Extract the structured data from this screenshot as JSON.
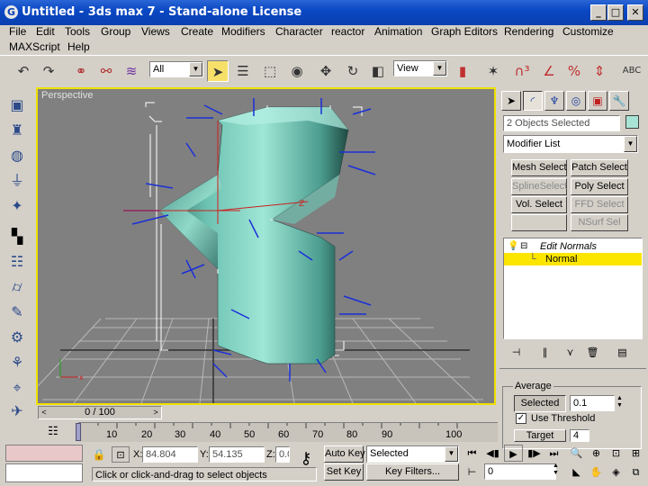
{
  "window": {
    "title": "Untitled - 3ds max 7 - Stand-alone License",
    "app_icon": "3ds-max-icon",
    "controls": [
      "_",
      "□",
      "✕"
    ]
  },
  "menu": {
    "row1": [
      "File",
      "Edit",
      "Tools",
      "Group",
      "Views",
      "Create",
      "Modifiers",
      "Character",
      "reactor",
      "Animation",
      "Graph Editors",
      "Rendering",
      "Customize"
    ],
    "row2": [
      "MAXScript",
      "Help"
    ]
  },
  "toolbar": {
    "selection_filter": "All",
    "coord_system": "View",
    "icons": [
      "undo-icon",
      "redo-icon",
      "link-icon",
      "unlink-icon",
      "bind-space-warp-icon",
      "select-object-icon",
      "select-by-name-icon",
      "rectangular-region-icon",
      "window-crossing-icon",
      "select-move-icon",
      "select-rotate-icon",
      "select-scale-icon",
      "use-pivot-center-icon",
      "select-manipulate-icon",
      "snap-icon",
      "angle-snap-icon",
      "percent-snap-icon",
      "spinner-snap-icon",
      "named-selection-icon",
      "mirror-icon"
    ]
  },
  "left_toolbar": {
    "icons": [
      "create-box-icon",
      "create-shirt-icon",
      "sphere-icon",
      "cylinder-icon",
      "hero-icon",
      "display-floater-icon",
      "geosphere-icon",
      "tube-icon",
      "brush-icon",
      "gear-icon",
      "wand-icon",
      "mouse-icon",
      "bird-icon",
      "dinosaur-icon"
    ]
  },
  "viewport": {
    "label": "Perspective",
    "accent": "#f0e000",
    "background": "#808080",
    "object_color": "#7fd4c4"
  },
  "command_panel": {
    "tabs": [
      "create-tab",
      "modify-tab",
      "hierarchy-tab",
      "motion-tab",
      "display-tab",
      "utilities-tab"
    ],
    "selection_info": "2 Objects Selected",
    "modifier_list": "Modifier List",
    "buttons": [
      {
        "label": "Mesh Select",
        "enabled": true
      },
      {
        "label": "Patch Select",
        "enabled": true
      },
      {
        "label": "SplineSelect",
        "enabled": false
      },
      {
        "label": "Poly Select",
        "enabled": true
      },
      {
        "label": "Vol. Select",
        "enabled": true
      },
      {
        "label": "FFD Select",
        "enabled": false
      },
      {
        "label": "",
        "enabled": false
      },
      {
        "label": "NSurf Sel",
        "enabled": false
      }
    ],
    "stack": {
      "modifier": "Edit Normals",
      "sub_object": "Normal"
    },
    "stack_tools": [
      "pin-stack-icon",
      "show-end-result-icon",
      "make-unique-icon",
      "remove-modifier-icon",
      "configure-modifier-sets-icon"
    ],
    "rollout": {
      "group_label": "Average",
      "selected_button": "Selected",
      "threshold_value": "0.1",
      "use_threshold_label": "Use Threshold",
      "use_threshold_checked": true,
      "target_label": "Target",
      "target_value": "4"
    }
  },
  "timeline": {
    "slider_label": "0 / 100",
    "ticks": [
      "0",
      "10",
      "20",
      "30",
      "40",
      "50",
      "60",
      "70",
      "80",
      "90",
      "100"
    ]
  },
  "status": {
    "x_label": "X:",
    "x_value": "84.804",
    "y_label": "Y:",
    "y_value": "54.135",
    "z_label": "Z:",
    "z_value": "0.0",
    "auto_key": "Auto Key",
    "set_key": "Set Key",
    "key_mode": "Selected",
    "key_filters": "Key Filters...",
    "frame": "0",
    "prompt": "Click or click-and-drag to select objects"
  }
}
